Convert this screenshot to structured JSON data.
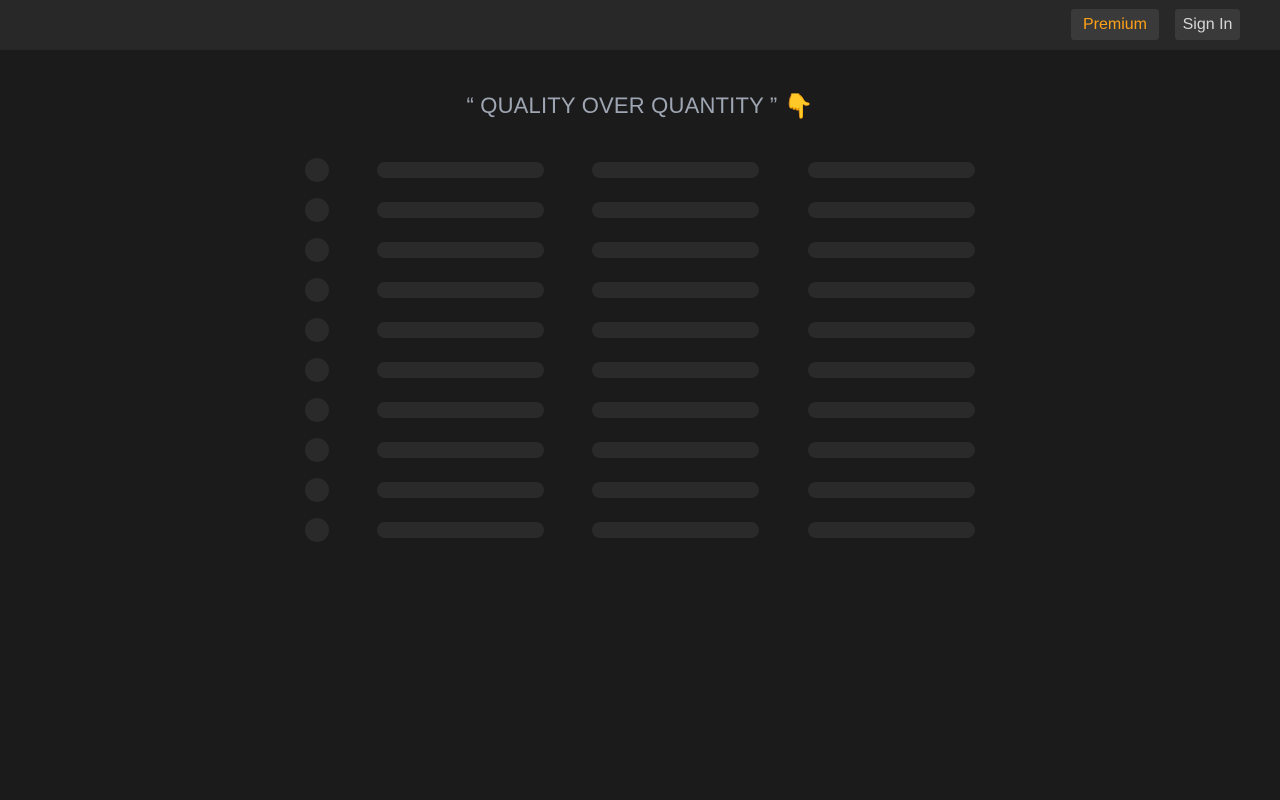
{
  "header": {
    "premium_label": "Premium",
    "signin_label": "Sign In"
  },
  "main": {
    "headline": "“ QUALITY OVER QUANTITY ”",
    "pointer_emoji": "👇"
  },
  "skeleton": {
    "rows": 10,
    "columns": 3
  },
  "colors": {
    "page_bg": "#1b1b1b",
    "topbar_bg": "#282828",
    "premium_accent": "#ffa116",
    "headline_text": "#9fa6b3",
    "skeleton_fill": "#2a2a2a"
  }
}
